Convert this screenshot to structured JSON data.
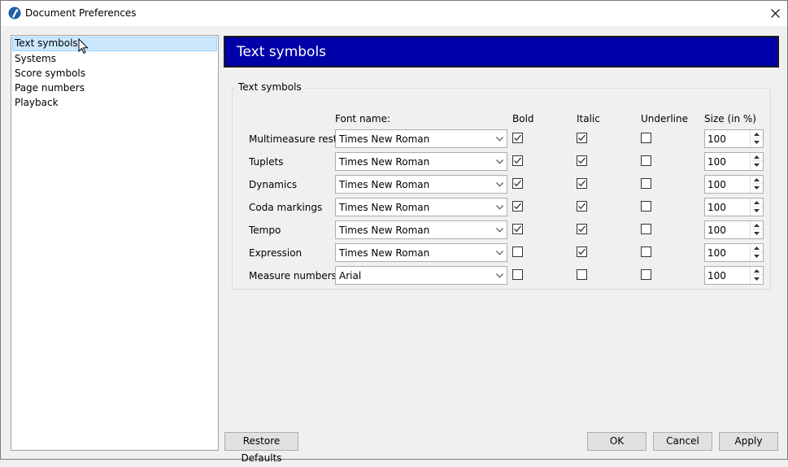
{
  "window": {
    "title": "Document Preferences"
  },
  "nav": {
    "items": [
      {
        "label": "Text symbols",
        "selected": true
      },
      {
        "label": "Systems",
        "selected": false
      },
      {
        "label": "Score symbols",
        "selected": false
      },
      {
        "label": "Page numbers",
        "selected": false
      },
      {
        "label": "Playback",
        "selected": false
      }
    ]
  },
  "banner": {
    "title": "Text symbols",
    "color": "#0000a8"
  },
  "group": {
    "title": "Text symbols",
    "headers": {
      "font_name": "Font name:",
      "bold": "Bold",
      "italic": "Italic",
      "underline": "Underline",
      "size": "Size (in %)"
    },
    "rows": [
      {
        "label": "Multimeasure rests",
        "font": "Times New Roman",
        "bold": true,
        "italic": true,
        "underline": false,
        "size": "100"
      },
      {
        "label": "Tuplets",
        "font": "Times New Roman",
        "bold": true,
        "italic": true,
        "underline": false,
        "size": "100"
      },
      {
        "label": "Dynamics",
        "font": "Times New Roman",
        "bold": true,
        "italic": true,
        "underline": false,
        "size": "100"
      },
      {
        "label": "Coda markings",
        "font": "Times New Roman",
        "bold": true,
        "italic": true,
        "underline": false,
        "size": "100"
      },
      {
        "label": "Tempo",
        "font": "Times New Roman",
        "bold": true,
        "italic": true,
        "underline": false,
        "size": "100"
      },
      {
        "label": "Expression",
        "font": "Times New Roman",
        "bold": false,
        "italic": true,
        "underline": false,
        "size": "100"
      },
      {
        "label": "Measure numbers",
        "font": "Arial",
        "bold": false,
        "italic": false,
        "underline": false,
        "size": "100"
      }
    ]
  },
  "buttons": {
    "restore": "Restore Defaults",
    "ok": "OK",
    "cancel": "Cancel",
    "apply": "Apply"
  }
}
